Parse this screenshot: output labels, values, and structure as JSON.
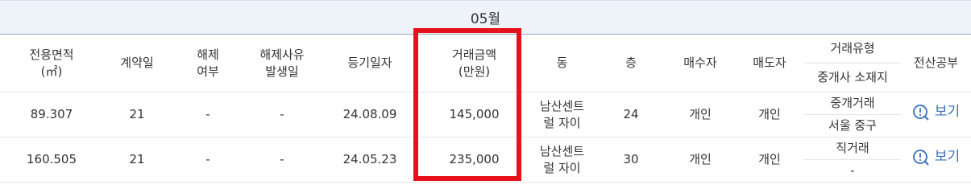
{
  "month_label": "05월",
  "headers": {
    "area": "전용면적",
    "area_unit": "(㎡)",
    "contract_day": "계약일",
    "cancel_line1": "해제",
    "cancel_line2": "여부",
    "cancel_reason_line1": "해제사유",
    "cancel_reason_line2": "발생일",
    "registration_date": "등기일자",
    "price_line1": "거래금액",
    "price_line2": "(만원)",
    "dong": "동",
    "floor": "층",
    "buyer": "매수자",
    "seller": "매도자",
    "deal_type": "거래유형",
    "broker_location": "중개사 소재지",
    "doc": "전산공부"
  },
  "rows": [
    {
      "area": "89.307",
      "contract_day": "21",
      "cancel": "-",
      "cancel_reason": "-",
      "registration_date": "24.08.09",
      "price": "145,000",
      "dong_line1": "남산센트",
      "dong_line2": "럴 자이",
      "floor": "24",
      "buyer": "개인",
      "seller": "개인",
      "deal_type": "중개거래",
      "broker_location": "서울 중구",
      "view_label": "보기"
    },
    {
      "area": "160.505",
      "contract_day": "21",
      "cancel": "-",
      "cancel_reason": "-",
      "registration_date": "24.05.23",
      "price": "235,000",
      "dong_line1": "남산센트",
      "dong_line2": "럴 자이",
      "floor": "30",
      "buyer": "개인",
      "seller": "개인",
      "deal_type": "직거래",
      "broker_location": "-",
      "view_label": "보기"
    }
  ],
  "colors": {
    "highlight": "#e8101a",
    "link": "#3a6fc4",
    "month_bar_bg": "#eef2f9"
  },
  "icons": {
    "view": "search-icon"
  }
}
